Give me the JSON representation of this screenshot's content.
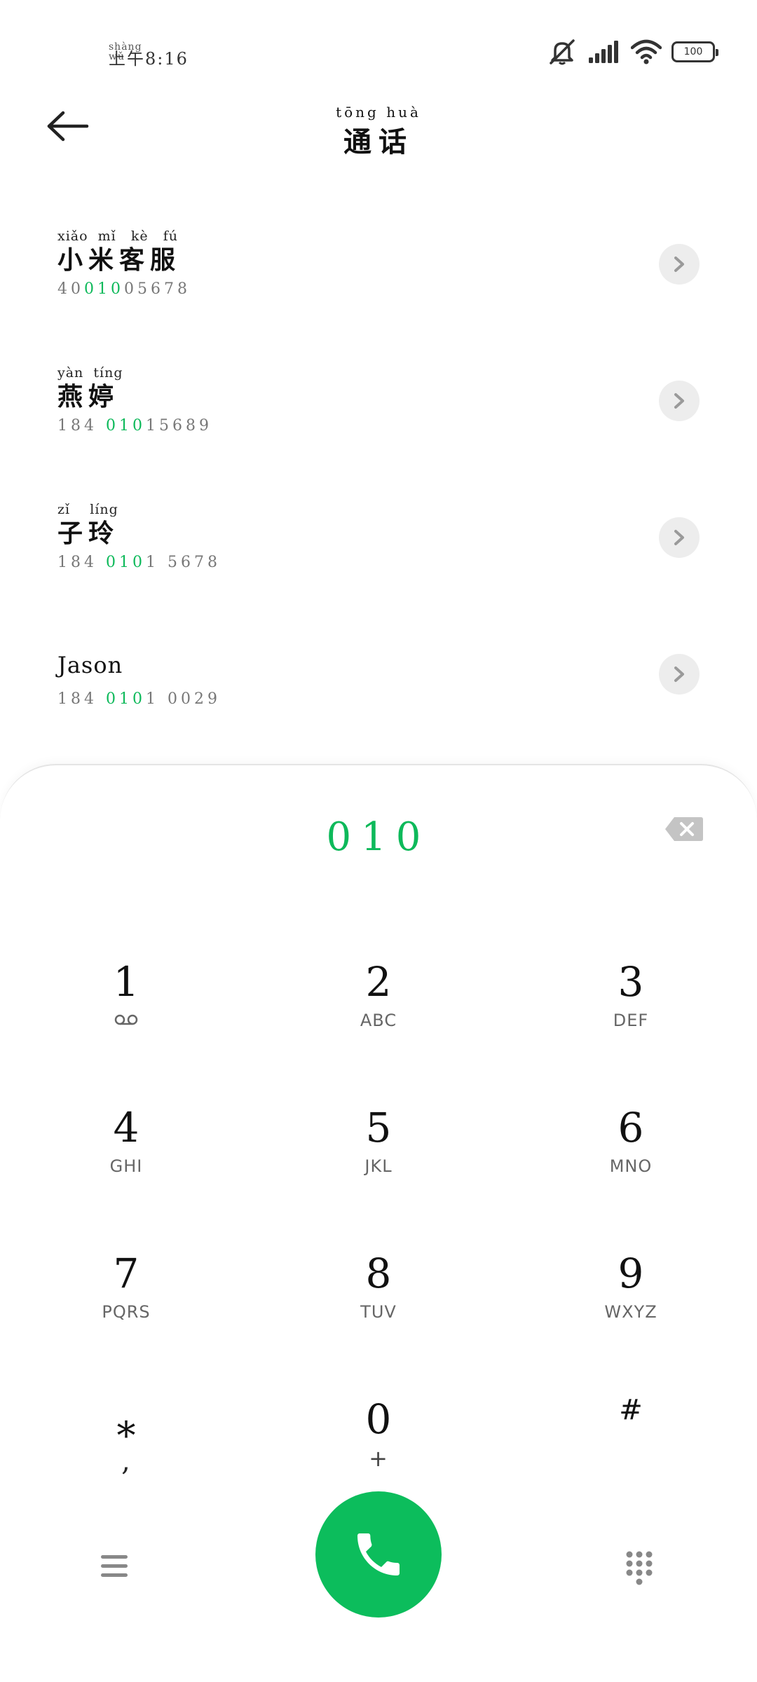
{
  "status_bar": {
    "time_ruby": "shàng wǔ",
    "time": "上午8:16",
    "battery": "100",
    "icons": [
      "mute-icon",
      "signal-icon",
      "wifi-icon",
      "battery-icon"
    ]
  },
  "header": {
    "title_ruby": "tōng huà",
    "title": "通话"
  },
  "contacts": [
    {
      "ruby": "xiǎo  mǐ   kè   fú",
      "name": "小米客服",
      "number_pre": "40",
      "number_hl": "010",
      "number_post": "05678"
    },
    {
      "ruby": "yàn  tíng",
      "name": "燕婷",
      "number_pre": "184 ",
      "number_hl": "010",
      "number_post": "15689"
    },
    {
      "ruby": "zǐ    líng",
      "name": "子玲",
      "number_pre": "184 ",
      "number_hl": "010",
      "number_post": "1 5678"
    },
    {
      "ruby": "",
      "name": "Jason",
      "number_pre": "184 ",
      "number_hl": "010",
      "number_post": "1 0029"
    }
  ],
  "dialer": {
    "entered": "010",
    "keys": [
      {
        "digit": "1",
        "sub": ""
      },
      {
        "digit": "2",
        "sub": "ABC"
      },
      {
        "digit": "3",
        "sub": "DEF"
      },
      {
        "digit": "4",
        "sub": "GHI"
      },
      {
        "digit": "5",
        "sub": "JKL"
      },
      {
        "digit": "6",
        "sub": "MNO"
      },
      {
        "digit": "7",
        "sub": "PQRS"
      },
      {
        "digit": "8",
        "sub": "TUV"
      },
      {
        "digit": "9",
        "sub": "WXYZ"
      },
      {
        "digit": "*",
        "sub": ","
      },
      {
        "digit": "0",
        "sub": "+"
      },
      {
        "digit": "#",
        "sub": ""
      }
    ]
  },
  "colors": {
    "accent": "#0cbd5c",
    "highlight": "#0db95a"
  }
}
